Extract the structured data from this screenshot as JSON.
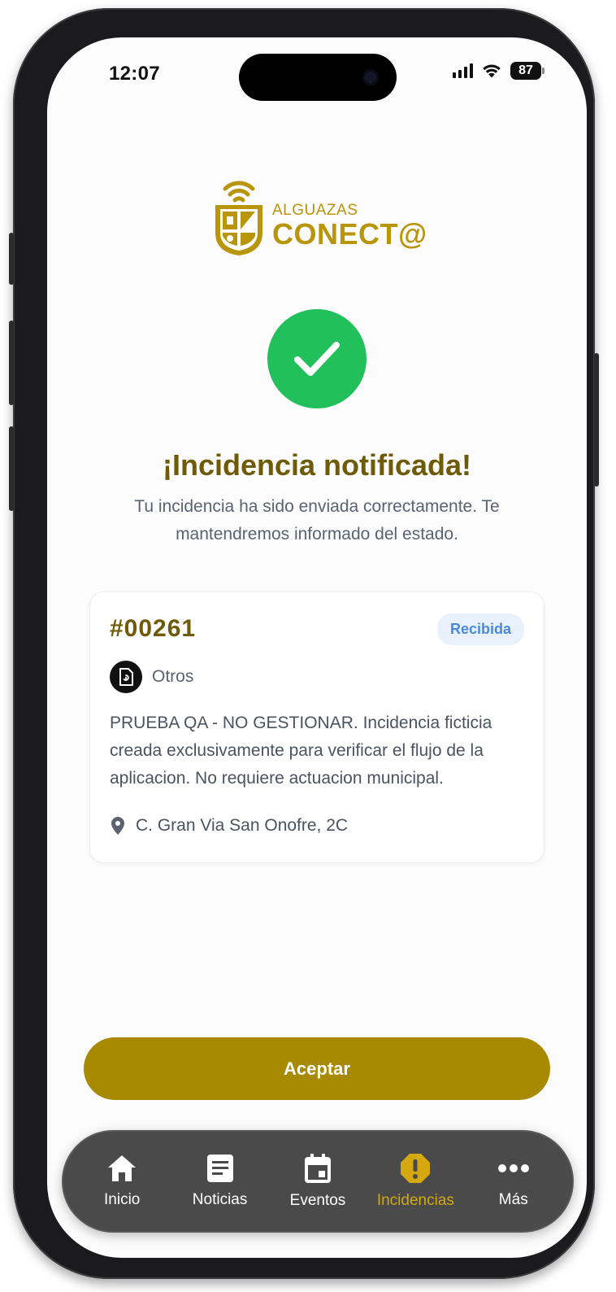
{
  "status_bar": {
    "time": "12:07",
    "battery": "87"
  },
  "logo": {
    "line1": "ALGUAZAS",
    "line2": "CONECT@"
  },
  "success": {
    "title": "¡Incidencia notificada!",
    "subtitle": "Tu incidencia ha sido enviada correctamente. Te mantendremos informado del estado."
  },
  "incident": {
    "id": "#00261",
    "status": "Recibida",
    "category": "Otros",
    "description": "PRUEBA QA - NO GESTIONAR. Incidencia ficticia creada exclusivamente para verificar el flujo de la aplicacion. No requiere actuacion municipal.",
    "address": "C. Gran Via San Onofre, 2C"
  },
  "accept_button": "Aceptar",
  "tab_bar": {
    "items": [
      {
        "label": "Inicio",
        "icon": "home-icon",
        "active": false
      },
      {
        "label": "Noticias",
        "icon": "news-icon",
        "active": false
      },
      {
        "label": "Eventos",
        "icon": "calendar-icon",
        "active": false
      },
      {
        "label": "Incidencias",
        "icon": "alert-icon",
        "active": true
      },
      {
        "label": "Más",
        "icon": "more-icon",
        "active": false
      }
    ]
  },
  "colors": {
    "brand_gold": "#a88902",
    "title_olive": "#6f5a07",
    "success_green": "#22c05a",
    "badge_blue": "#4a8ad8",
    "active_tab": "#d4a80e"
  }
}
